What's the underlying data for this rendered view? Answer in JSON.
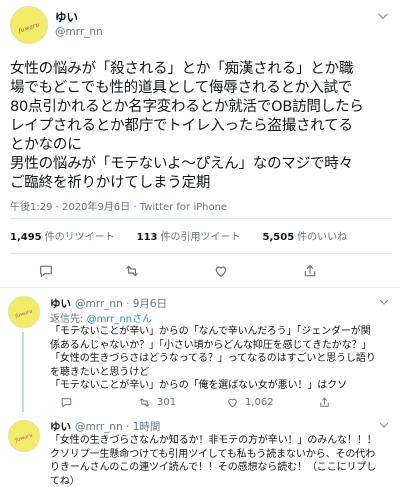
{
  "tweet": {
    "name": "ゆい",
    "handle": "@mrr_nn",
    "avatar_text": "fuwaru",
    "text": "女性の悩みが「殺される」とか「痴漢される」とか職\n場でもどこでも性的道具として侮辱されるとか入試で\n80点引かれるとか名字変わるとか就活でOB訪問したら\nレイプされるとか都庁でトイレ入ったら盗撮されてる\nとかなのに\n男性の悩みが「モテないよ〜ぴえん」なのマジで時々\nご臨終を祈りかけてしまう定期",
    "time": "午後1:29 · 2020年9月6日 · ",
    "client": "Twitter for iPhone",
    "stats": {
      "retweets": "1,495",
      "retweets_label": "件のリツイート",
      "quotes": "113",
      "quotes_label": "件の引用ツイート",
      "likes": "5,505",
      "likes_label": "件のいいね"
    }
  },
  "replies": [
    {
      "name": "ゆい",
      "handle": "@mrr_nn · 9月6日",
      "reply_to_prefix": "返信先: ",
      "reply_to": "@mrr_nnさん",
      "text": "「モテないことが辛い」からの「なんで辛いんだろう」「ジェンダーが関\n係あるんじゃないか？」「小さい頃からどんな抑圧を感じてきたかな？」\n「女性の生きづらさはどうなってる？」ってなるのはすごいと思うし語り\nを聴きたいと思うけど\n「モテないことが辛い」からの「俺を選ばない女が悪い！」はクソ",
      "retweets": "301",
      "likes": "1,062"
    },
    {
      "name": "ゆい",
      "handle": "@mrr_nn · 1時間",
      "text": "「女性の生きづらさなんか知るか！非モテの方が辛い！」のみんな！！！\nクソリプ一生懸命つけても引用ツイしても私もう読まないから、その代わ\nりきーんさんのこの連ツイ読んで！！その感想なら読む！（ここにリプし\nてね）"
    }
  ]
}
